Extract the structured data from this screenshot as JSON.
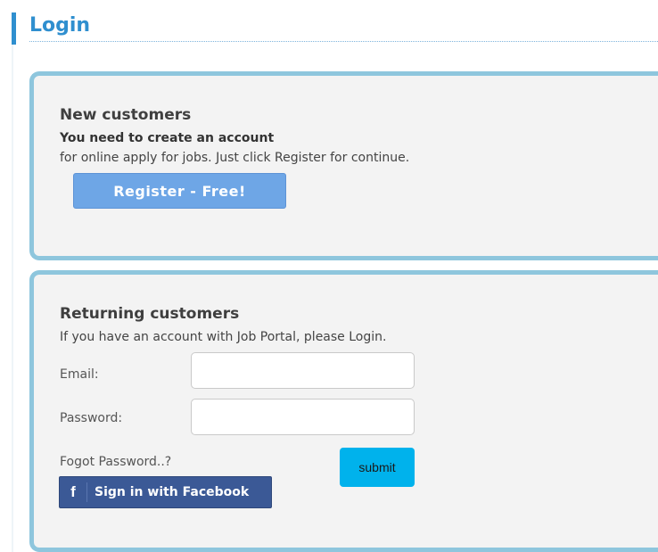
{
  "header": {
    "title": "Login"
  },
  "new_customers": {
    "heading": "New customers",
    "subheading": "You need to create an account",
    "description": "for online apply for jobs. Just click Register for continue.",
    "register_label": "Register - Free!"
  },
  "returning_customers": {
    "heading": "Returning customers",
    "description": "If you have an account with Job Portal, please Login.",
    "email_label": "Email:",
    "email_value": "",
    "password_label": "Password:",
    "password_value": "",
    "forgot_label": "Fogot Password..?",
    "submit_label": "submit",
    "facebook_label": "Sign in with Facebook",
    "facebook_icon": "facebook-f-icon"
  },
  "colors": {
    "accent": "#2f8fcf",
    "panel_border": "#8ec6dd",
    "register_button": "#6ea6e6",
    "submit_button": "#00b2ec",
    "facebook_button": "#3b5996"
  }
}
